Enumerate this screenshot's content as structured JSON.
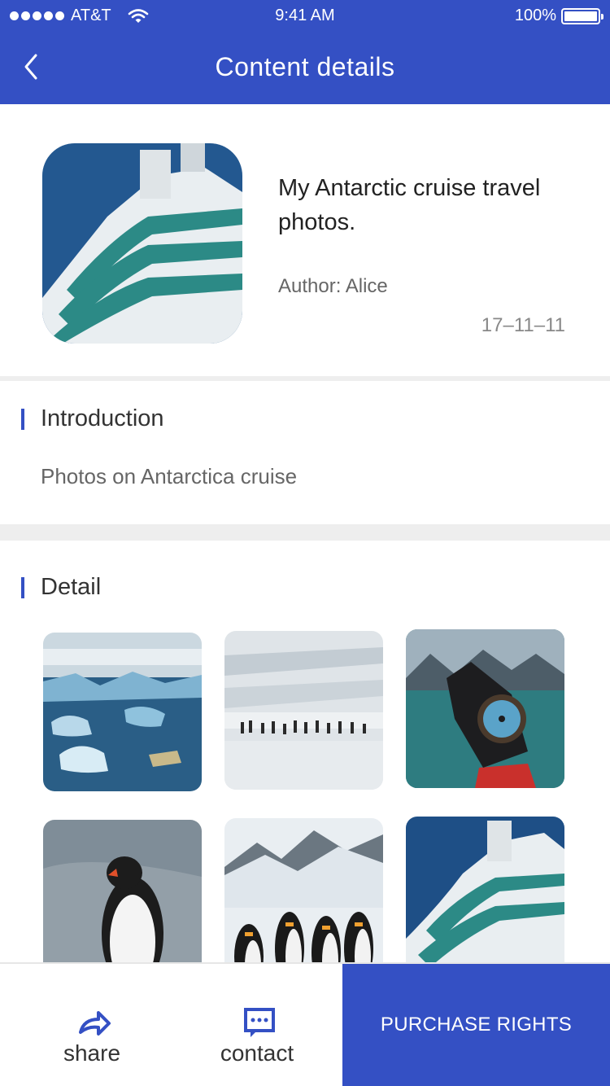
{
  "status_bar": {
    "carrier": "AT&T",
    "time": "9:41 AM",
    "battery": "100%"
  },
  "nav": {
    "title": "Content details",
    "back_icon": "chevron-left-icon"
  },
  "content": {
    "title": "My Antarctic cruise travel photos.",
    "author": "Author: Alice",
    "date": "17–11–11"
  },
  "introduction": {
    "heading": "Introduction",
    "text": "Photos on Antarctica cruise"
  },
  "detail": {
    "heading": "Detail",
    "photos": [
      "glacier-ice-photo",
      "penguin-colony-photo",
      "compass-hand-photo",
      "gentoo-penguin-photo",
      "king-penguins-photo",
      "cruise-ship-photo"
    ]
  },
  "bottom_bar": {
    "share_label": "share",
    "contact_label": "contact",
    "purchase_label": "PURCHASE RIGHTS"
  },
  "colors": {
    "brand": "#3450C4",
    "separator": "#eeeeee"
  }
}
